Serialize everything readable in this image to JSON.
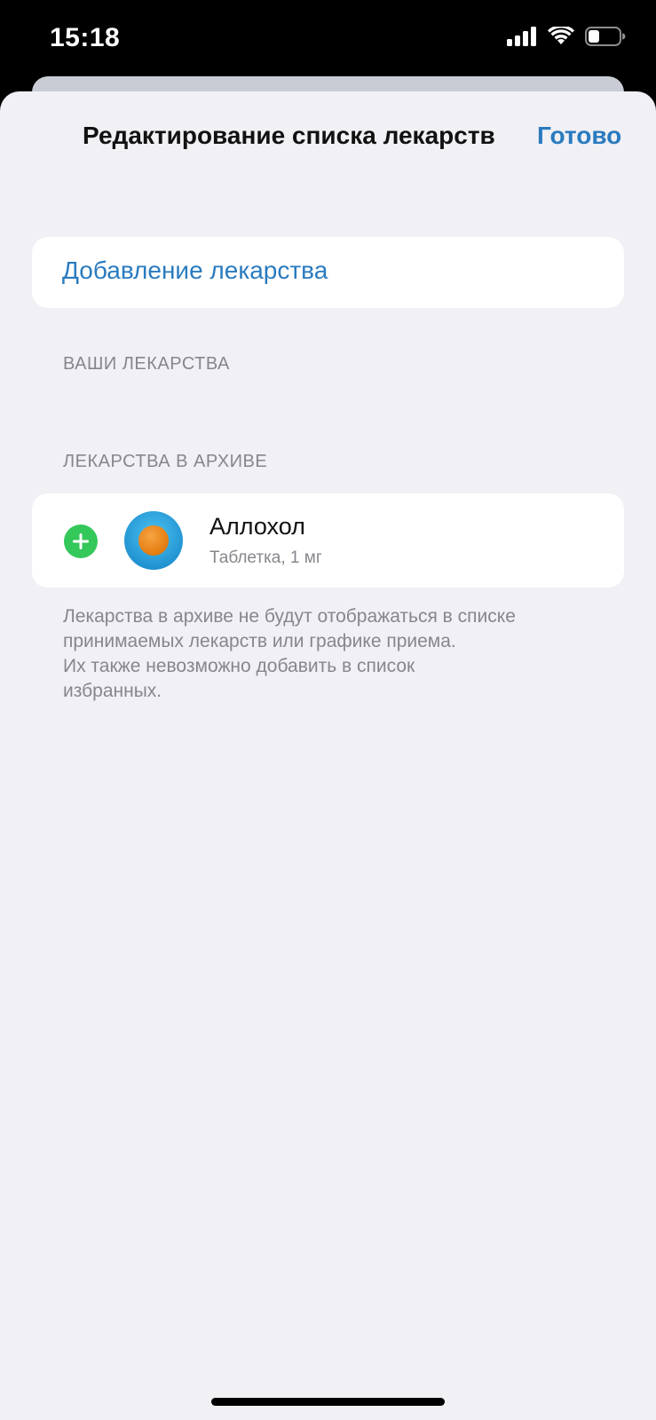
{
  "status_bar": {
    "time": "15:18",
    "icons": [
      "cellular-signal-icon",
      "wifi-icon",
      "battery-icon"
    ]
  },
  "nav": {
    "title": "Редактирование списка лекарств",
    "done_label": "Готово"
  },
  "add_medication": {
    "label": "Добавление лекарства"
  },
  "sections": {
    "your_meds_header": "ВАШИ ЛЕКАРСТВА",
    "archived_header": "ЛЕКАРСТВА В АРХИВЕ"
  },
  "archived_items": [
    {
      "name": "Аллохол",
      "details": "Таблетка, 1 мг",
      "icon": "pill-icon"
    }
  ],
  "footnote": {
    "line1": "Лекарства в архиве не будут отображаться в списке",
    "line2": "принимаемых лекарств или графике приема.",
    "line3": "Их также невозможно добавить в список",
    "line4": "избранных."
  },
  "colors": {
    "accent": "#2a7bbf",
    "add_button": "#34c759",
    "pill_outer": "#2fa8e0",
    "pill_inner": "#f28c1c",
    "background": "#f0f0f5",
    "secondary_text": "#86868c"
  }
}
